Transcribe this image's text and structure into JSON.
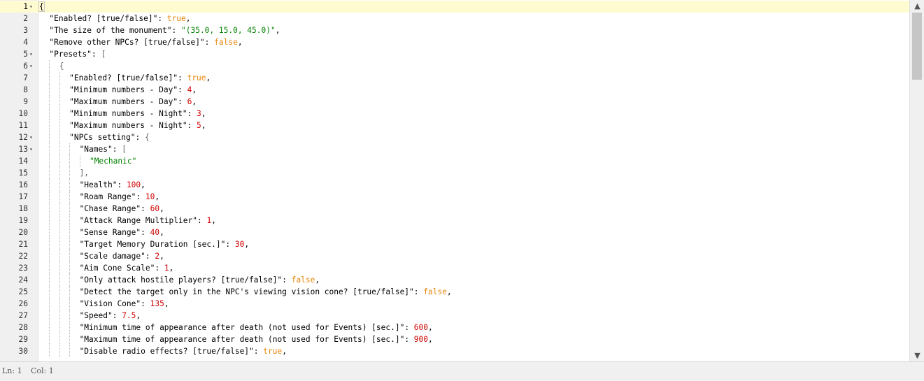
{
  "editor": {
    "lines": [
      {
        "n": "1",
        "fold": true,
        "indent": 0,
        "tokens": [
          {
            "t": "{",
            "c": "p"
          }
        ]
      },
      {
        "n": "2",
        "indent": 1,
        "tokens": [
          {
            "t": "\"Enabled? [true/false]\"",
            "c": "k"
          },
          {
            "t": ": ",
            "c": "p"
          },
          {
            "t": "true",
            "c": "b"
          },
          {
            "t": ",",
            "c": "p"
          }
        ]
      },
      {
        "n": "3",
        "indent": 1,
        "tokens": [
          {
            "t": "\"The size of the monument\"",
            "c": "k"
          },
          {
            "t": ": ",
            "c": "p"
          },
          {
            "t": "\"(35.0, 15.0, 45.0)\"",
            "c": "s"
          },
          {
            "t": ",",
            "c": "p"
          }
        ]
      },
      {
        "n": "4",
        "indent": 1,
        "tokens": [
          {
            "t": "\"Remove other NPCs? [true/false]\"",
            "c": "k"
          },
          {
            "t": ": ",
            "c": "p"
          },
          {
            "t": "false",
            "c": "b"
          },
          {
            "t": ",",
            "c": "p"
          }
        ]
      },
      {
        "n": "5",
        "fold": true,
        "indent": 1,
        "tokens": [
          {
            "t": "\"Presets\"",
            "c": "k"
          },
          {
            "t": ": ",
            "c": "p"
          },
          {
            "t": "[",
            "c": "pb"
          }
        ]
      },
      {
        "n": "6",
        "fold": true,
        "indent": 2,
        "tokens": [
          {
            "t": "{",
            "c": "pb"
          }
        ]
      },
      {
        "n": "7",
        "indent": 3,
        "tokens": [
          {
            "t": "\"Enabled? [true/false]\"",
            "c": "k"
          },
          {
            "t": ": ",
            "c": "p"
          },
          {
            "t": "true",
            "c": "b"
          },
          {
            "t": ",",
            "c": "p"
          }
        ]
      },
      {
        "n": "8",
        "indent": 3,
        "tokens": [
          {
            "t": "\"Minimum numbers - Day\"",
            "c": "k"
          },
          {
            "t": ": ",
            "c": "p"
          },
          {
            "t": "4",
            "c": "n"
          },
          {
            "t": ",",
            "c": "p"
          }
        ]
      },
      {
        "n": "9",
        "indent": 3,
        "tokens": [
          {
            "t": "\"Maximum numbers - Day\"",
            "c": "k"
          },
          {
            "t": ": ",
            "c": "p"
          },
          {
            "t": "6",
            "c": "n"
          },
          {
            "t": ",",
            "c": "p"
          }
        ]
      },
      {
        "n": "10",
        "indent": 3,
        "tokens": [
          {
            "t": "\"Minimum numbers - Night\"",
            "c": "k"
          },
          {
            "t": ": ",
            "c": "p"
          },
          {
            "t": "3",
            "c": "n"
          },
          {
            "t": ",",
            "c": "p"
          }
        ]
      },
      {
        "n": "11",
        "indent": 3,
        "tokens": [
          {
            "t": "\"Maximum numbers - Night\"",
            "c": "k"
          },
          {
            "t": ": ",
            "c": "p"
          },
          {
            "t": "5",
            "c": "n"
          },
          {
            "t": ",",
            "c": "p"
          }
        ]
      },
      {
        "n": "12",
        "fold": true,
        "indent": 3,
        "tokens": [
          {
            "t": "\"NPCs setting\"",
            "c": "k"
          },
          {
            "t": ": ",
            "c": "p"
          },
          {
            "t": "{",
            "c": "pb"
          }
        ]
      },
      {
        "n": "13",
        "fold": true,
        "indent": 4,
        "tokens": [
          {
            "t": "\"Names\"",
            "c": "k"
          },
          {
            "t": ": ",
            "c": "p"
          },
          {
            "t": "[",
            "c": "pb"
          }
        ]
      },
      {
        "n": "14",
        "indent": 5,
        "tokens": [
          {
            "t": "\"Mechanic\"",
            "c": "s"
          }
        ]
      },
      {
        "n": "15",
        "indent": 4,
        "tokens": [
          {
            "t": "],",
            "c": "pb"
          }
        ]
      },
      {
        "n": "16",
        "indent": 4,
        "tokens": [
          {
            "t": "\"Health\"",
            "c": "k"
          },
          {
            "t": ": ",
            "c": "p"
          },
          {
            "t": "100",
            "c": "n"
          },
          {
            "t": ",",
            "c": "p"
          }
        ]
      },
      {
        "n": "17",
        "indent": 4,
        "tokens": [
          {
            "t": "\"Roam Range\"",
            "c": "k"
          },
          {
            "t": ": ",
            "c": "p"
          },
          {
            "t": "10",
            "c": "n"
          },
          {
            "t": ",",
            "c": "p"
          }
        ]
      },
      {
        "n": "18",
        "indent": 4,
        "tokens": [
          {
            "t": "\"Chase Range\"",
            "c": "k"
          },
          {
            "t": ": ",
            "c": "p"
          },
          {
            "t": "60",
            "c": "n"
          },
          {
            "t": ",",
            "c": "p"
          }
        ]
      },
      {
        "n": "19",
        "indent": 4,
        "tokens": [
          {
            "t": "\"Attack Range Multiplier\"",
            "c": "k"
          },
          {
            "t": ": ",
            "c": "p"
          },
          {
            "t": "1",
            "c": "n"
          },
          {
            "t": ",",
            "c": "p"
          }
        ]
      },
      {
        "n": "20",
        "indent": 4,
        "tokens": [
          {
            "t": "\"Sense Range\"",
            "c": "k"
          },
          {
            "t": ": ",
            "c": "p"
          },
          {
            "t": "40",
            "c": "n"
          },
          {
            "t": ",",
            "c": "p"
          }
        ]
      },
      {
        "n": "21",
        "indent": 4,
        "tokens": [
          {
            "t": "\"Target Memory Duration [sec.]\"",
            "c": "k"
          },
          {
            "t": ": ",
            "c": "p"
          },
          {
            "t": "30",
            "c": "n"
          },
          {
            "t": ",",
            "c": "p"
          }
        ]
      },
      {
        "n": "22",
        "indent": 4,
        "tokens": [
          {
            "t": "\"Scale damage\"",
            "c": "k"
          },
          {
            "t": ": ",
            "c": "p"
          },
          {
            "t": "2",
            "c": "n"
          },
          {
            "t": ",",
            "c": "p"
          }
        ]
      },
      {
        "n": "23",
        "indent": 4,
        "tokens": [
          {
            "t": "\"Aim Cone Scale\"",
            "c": "k"
          },
          {
            "t": ": ",
            "c": "p"
          },
          {
            "t": "1",
            "c": "n"
          },
          {
            "t": ",",
            "c": "p"
          }
        ]
      },
      {
        "n": "24",
        "indent": 4,
        "tokens": [
          {
            "t": "\"Only attack hostile players? [true/false]\"",
            "c": "k"
          },
          {
            "t": ": ",
            "c": "p"
          },
          {
            "t": "false",
            "c": "b"
          },
          {
            "t": ",",
            "c": "p"
          }
        ]
      },
      {
        "n": "25",
        "indent": 4,
        "tokens": [
          {
            "t": "\"Detect the target only in the NPC's viewing vision cone? [true/false]\"",
            "c": "k"
          },
          {
            "t": ": ",
            "c": "p"
          },
          {
            "t": "false",
            "c": "b"
          },
          {
            "t": ",",
            "c": "p"
          }
        ]
      },
      {
        "n": "26",
        "indent": 4,
        "tokens": [
          {
            "t": "\"Vision Cone\"",
            "c": "k"
          },
          {
            "t": ": ",
            "c": "p"
          },
          {
            "t": "135",
            "c": "n"
          },
          {
            "t": ",",
            "c": "p"
          }
        ]
      },
      {
        "n": "27",
        "indent": 4,
        "tokens": [
          {
            "t": "\"Speed\"",
            "c": "k"
          },
          {
            "t": ": ",
            "c": "p"
          },
          {
            "t": "7.5",
            "c": "n"
          },
          {
            "t": ",",
            "c": "p"
          }
        ]
      },
      {
        "n": "28",
        "indent": 4,
        "tokens": [
          {
            "t": "\"Minimum time of appearance after death (not used for Events) [sec.]\"",
            "c": "k"
          },
          {
            "t": ": ",
            "c": "p"
          },
          {
            "t": "600",
            "c": "n"
          },
          {
            "t": ",",
            "c": "p"
          }
        ]
      },
      {
        "n": "29",
        "indent": 4,
        "tokens": [
          {
            "t": "\"Maximum time of appearance after death (not used for Events) [sec.]\"",
            "c": "k"
          },
          {
            "t": ": ",
            "c": "p"
          },
          {
            "t": "900",
            "c": "n"
          },
          {
            "t": ",",
            "c": "p"
          }
        ]
      },
      {
        "n": "30",
        "indent": 4,
        "tokens": [
          {
            "t": "\"Disable radio effects? [true/false]\"",
            "c": "k"
          },
          {
            "t": ": ",
            "c": "p"
          },
          {
            "t": "true",
            "c": "b"
          },
          {
            "t": ",",
            "c": "p"
          }
        ]
      }
    ]
  },
  "status": {
    "line": "Ln: 1",
    "col": "Col: 1"
  },
  "scrollbar": {
    "up_glyph": "▲",
    "down_glyph": "▼"
  },
  "fold_glyph": "▾",
  "colors": {
    "string": "#008000",
    "boolean": "#e8870b",
    "number": "#d00000",
    "active_line": "#fffbd1"
  }
}
